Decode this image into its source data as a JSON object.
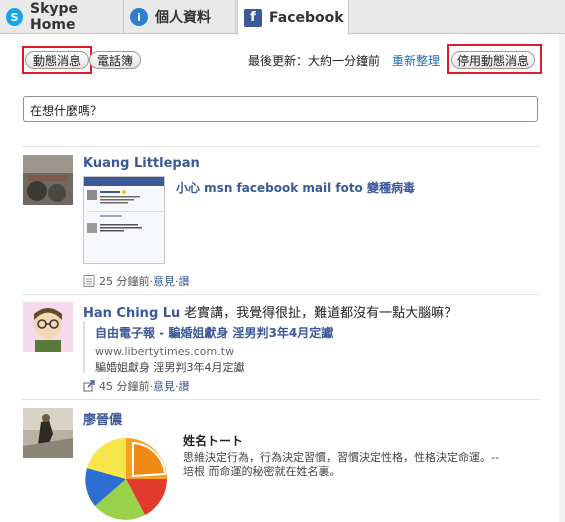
{
  "tabs": [
    {
      "label": "Skype Home",
      "icon": "skype-icon"
    },
    {
      "label": "個人資料",
      "icon": "info-icon"
    },
    {
      "label": "Facebook",
      "icon": "facebook-icon",
      "active": true
    }
  ],
  "toolbar": {
    "news_feed_label": "動態消息",
    "phonebook_label": "電話簿",
    "last_updated": "最後更新：大約一分鐘前",
    "refresh_label": "重新整理",
    "disable_feed_label": "停用動態消息"
  },
  "status_input": {
    "placeholder": "在想什麼嗎？"
  },
  "feed": [
    {
      "name": "Kuang Littlepan",
      "attachment_title": "小心 msn facebook mail foto 變種病毒",
      "time": "25 分鐘前",
      "comment": "意見",
      "like": "讚"
    },
    {
      "name": "Han Ching Lu",
      "message": "老實講，我覺得很扯，難道都沒有一點大腦嘛？",
      "link_title": "自由電子報 - 騙婚姐獻身 淫男判3年4月定讞",
      "link_url": "www.libertytimes.com.tw",
      "link_desc": "騙婚姐獻身 淫男判3年4月定讞",
      "time": "45 分鐘前",
      "comment": "意見",
      "like": "讚"
    },
    {
      "name": "廖晉儂",
      "attachment_title": "姓名トート",
      "attachment_desc_1": "思維決定行為，行為決定習慣，習慣決定性格，性格決定命運。--",
      "attachment_desc_2": "培根 而命運的秘密就在姓名裏。"
    }
  ],
  "sep": " · ",
  "colors": {
    "facebook_blue": "#3b5998",
    "highlight_red": "#e0192b",
    "link_blue": "#1c6fb9"
  }
}
